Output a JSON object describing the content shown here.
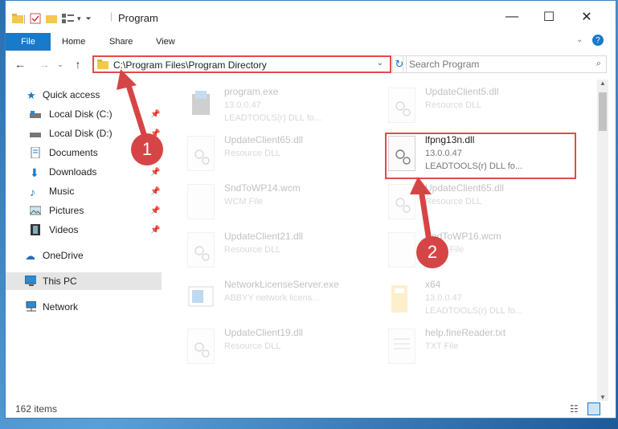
{
  "window": {
    "title": "Program",
    "controls": {
      "minimize": "—",
      "maximize": "☐",
      "close": "✕"
    }
  },
  "ribbon": {
    "file": "File",
    "tabs": [
      "Home",
      "Share",
      "View"
    ]
  },
  "address": {
    "path": "C:\\Program Files\\Program Directory"
  },
  "search": {
    "placeholder": "Search Program"
  },
  "sidebar": {
    "items": [
      {
        "label": "Quick access"
      },
      {
        "label": "Local Disk (C:)"
      },
      {
        "label": "Local Disk (D:)"
      },
      {
        "label": "Documents"
      },
      {
        "label": "Downloads"
      },
      {
        "label": "Music"
      },
      {
        "label": "Pictures"
      },
      {
        "label": "Videos"
      },
      {
        "label": "OneDrive"
      },
      {
        "label": "This PC"
      },
      {
        "label": "Network"
      }
    ]
  },
  "files": {
    "left": [
      {
        "name": "program.exe",
        "line2": "13.0.0.47",
        "line3": "LEADTOOLS(r) DLL fo..."
      },
      {
        "name": "UpdateClient65.dll",
        "line2": "Resource DLL",
        "line3": ""
      },
      {
        "name": "SndToWP14.wcm",
        "line2": "WCM File",
        "line3": ""
      },
      {
        "name": "UpdateClient21.dll",
        "line2": "Resource DLL",
        "line3": ""
      },
      {
        "name": "NetworkLicenseServer.exe",
        "line2": "ABBYY network licens...",
        "line3": ""
      },
      {
        "name": "UpdateClient19.dll",
        "line2": "Resource DLL",
        "line3": ""
      }
    ],
    "right": [
      {
        "name": "UpdateClient5.dll",
        "line2": "Resource DLL",
        "line3": ""
      },
      {
        "name": "lfpng13n.dll",
        "line2": "13.0.0.47",
        "line3": "LEADTOOLS(r) DLL fo..."
      },
      {
        "name": "UpdateClient65.dll",
        "line2": "Resource DLL",
        "line3": ""
      },
      {
        "name": "SndToWP16.wcm",
        "line2": "WCM File",
        "line3": ""
      },
      {
        "name": "x64",
        "line2": "13.0.0.47",
        "line3": "LEADTOOLS(r) DLL fo..."
      },
      {
        "name": "help.fineReader.txt",
        "line2": "TXT File",
        "line3": ""
      }
    ]
  },
  "status": {
    "items": "162 items"
  },
  "annotations": {
    "badge1": "1",
    "badge2": "2"
  },
  "colors": {
    "accent": "#1979ca",
    "annotation": "#e24b4b"
  }
}
